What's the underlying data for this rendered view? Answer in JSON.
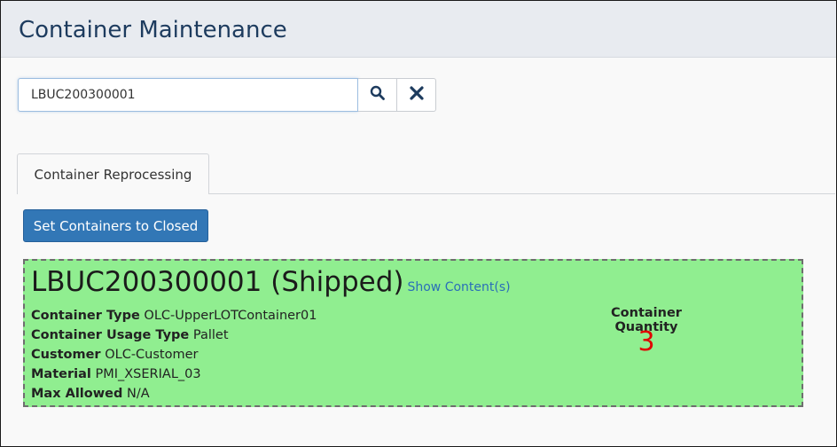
{
  "header": {
    "title": "Container Maintenance"
  },
  "search": {
    "value": "LBUC200300001"
  },
  "icons": {
    "search": "search-icon",
    "clear": "close-icon"
  },
  "tabs": [
    {
      "label": "Container Reprocessing"
    }
  ],
  "actions": {
    "set_closed_label": "Set Containers to Closed"
  },
  "container": {
    "heading": "LBUC200300001 (Shipped)",
    "show_contents_label": "Show Content(s)",
    "properties": [
      {
        "key": "Container Type",
        "value": "OLC-UpperLOTContainer01"
      },
      {
        "key": "Container Usage Type",
        "value": "Pallet"
      },
      {
        "key": "Customer",
        "value": "OLC-Customer"
      },
      {
        "key": "Material",
        "value": "PMI_XSERIAL_03"
      },
      {
        "key": "Max Allowed",
        "value": "N/A"
      }
    ],
    "quantity_label": "Container Quantity",
    "quantity_value": "3"
  },
  "colors": {
    "header_bg": "#e8ebf0",
    "title": "#1d3b5e",
    "primary_button": "#3277b6",
    "card_bg": "#90ee90",
    "link": "#2a6fb8",
    "quantity": "#e00000"
  }
}
